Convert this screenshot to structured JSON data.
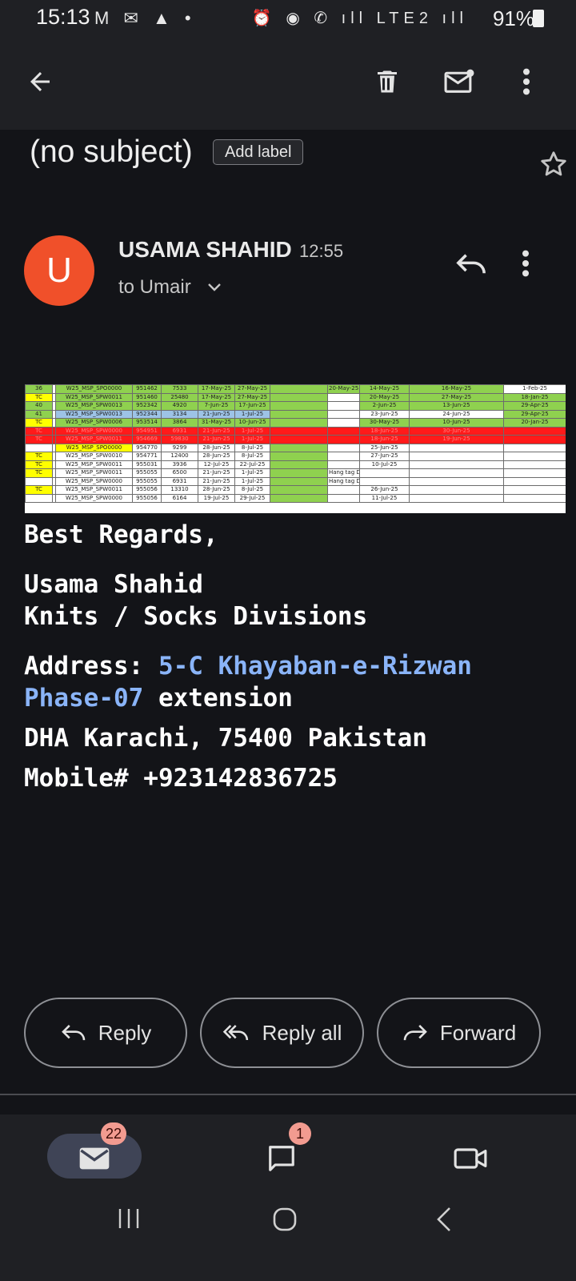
{
  "status_bar": {
    "time": "15:13",
    "left_icons": "M ✉ ▲ •",
    "battery": "91%",
    "right_icons": "⏰ ◉ ✆ ıll LTE2 ıll"
  },
  "email": {
    "subject": "(no subject)",
    "add_label": "Add label",
    "sender": "USAMA SHAHID",
    "avatar_letter": "U",
    "time": "12:55",
    "recipient": "to Umair"
  },
  "spreadsheet": {
    "rows": [
      [
        "36",
        "",
        "W25_MSP_SPO0000",
        "951462",
        "7533",
        "17-May-25",
        "27-May-25",
        "",
        "20-May-25",
        "14-May-25",
        "16-May-25",
        "1-Feb-25"
      ],
      [
        "TC",
        "",
        "W25_MSP_SPW0011",
        "951460",
        "25480",
        "17-May-25",
        "27-May-25",
        "",
        "",
        "20-May-25",
        "27-May-25",
        "18-Jan-25"
      ],
      [
        "40",
        "",
        "W25_MSP_SPW0013",
        "952342",
        "4920",
        "7-Jun-25",
        "17-Jun-25",
        "",
        "",
        "2-Jun-25",
        "13-Jun-25",
        "29-Apr-25"
      ],
      [
        "41",
        "",
        "W25_MSP_SPW0013",
        "952344",
        "3134",
        "21-Jun-25",
        "1-Jul-25",
        "",
        "",
        "23-Jun-25",
        "24-Jun-25",
        "29-Apr-25"
      ],
      [
        "TC",
        "",
        "W25_MSP_SPW0006",
        "953514",
        "3864",
        "31-May-25",
        "10-Jun-25",
        "",
        "",
        "30-May-25",
        "10-Jun-25",
        "20-Jan-25"
      ],
      [
        "TC",
        "",
        "W25_MSP_SPW0000",
        "954951",
        "6931",
        "21-Jun-25",
        "1-Jul-25",
        "",
        "",
        "18-Jun-25",
        "30-Jun-25",
        ""
      ],
      [
        "TC",
        "",
        "W25_MSP_SPW0011",
        "954669",
        "59830",
        "21-Jun-25",
        "1-Jul-25",
        "",
        "",
        "18-Jun-25",
        "19-Jun-25",
        ""
      ],
      [
        "",
        "",
        "W25_MSP_SPO0000",
        "954770",
        "9299",
        "28-Jun-25",
        "8-Jul-25",
        "",
        "",
        "25-Jun-25",
        "",
        ""
      ],
      [
        "TC",
        "",
        "W25_MSP_SPW0010",
        "954771",
        "12400",
        "28-Jun-25",
        "8-Jul-25",
        "",
        "",
        "27-Jun-25",
        "",
        ""
      ],
      [
        "TC",
        "",
        "W25_MSP_SPW0011",
        "955031",
        "3936",
        "12-Jul-25",
        "22-Jul-25",
        "",
        "",
        "10-Jul-25",
        "",
        ""
      ],
      [
        "TC",
        "",
        "W25_MSP_SPW0011",
        "955055",
        "6500",
        "21-Jun-25",
        "1-Jul-25",
        "",
        "Hang tag Delivery Date",
        "",
        "",
        ""
      ],
      [
        "",
        "",
        "W25_MSP_SPW0000",
        "955055",
        "6931",
        "21-Jun-25",
        "1-Jul-25",
        "",
        "Hang tag Delivery Date",
        "",
        "",
        ""
      ],
      [
        "TC",
        "",
        "W25_MSP_SPW0011",
        "955056",
        "13310",
        "28-Jun-25",
        "8-Jul-25",
        "",
        "",
        "26-Jun-25",
        "",
        ""
      ],
      [
        "",
        "",
        "W25_MSP_SPW0000",
        "955056",
        "6164",
        "19-Jul-25",
        "29-Jul-25",
        "",
        "",
        "11-Jul-25",
        "",
        ""
      ]
    ]
  },
  "signature": {
    "greeting": "Best Regards,",
    "name": "Usama Shahid",
    "division": "Knits / Socks Divisions",
    "address_label": "Address: ",
    "address_link_1": "5-C Khayaban-e-Rizwan",
    "address_link_2": "Phase-07",
    "address_rest": " extension",
    "city": "DHA Karachi, 75400 Pakistan",
    "mobile": "Mobile# +923142836725"
  },
  "actions": {
    "reply": "Reply",
    "reply_all": "Reply all",
    "forward": "Forward"
  },
  "bottom_nav": {
    "mail_badge": "22",
    "chat_badge": "1"
  },
  "colors": {
    "background": "#131418",
    "avatar": "#f0502a",
    "link": "#8ab4f8",
    "badge": "#f29b90"
  }
}
